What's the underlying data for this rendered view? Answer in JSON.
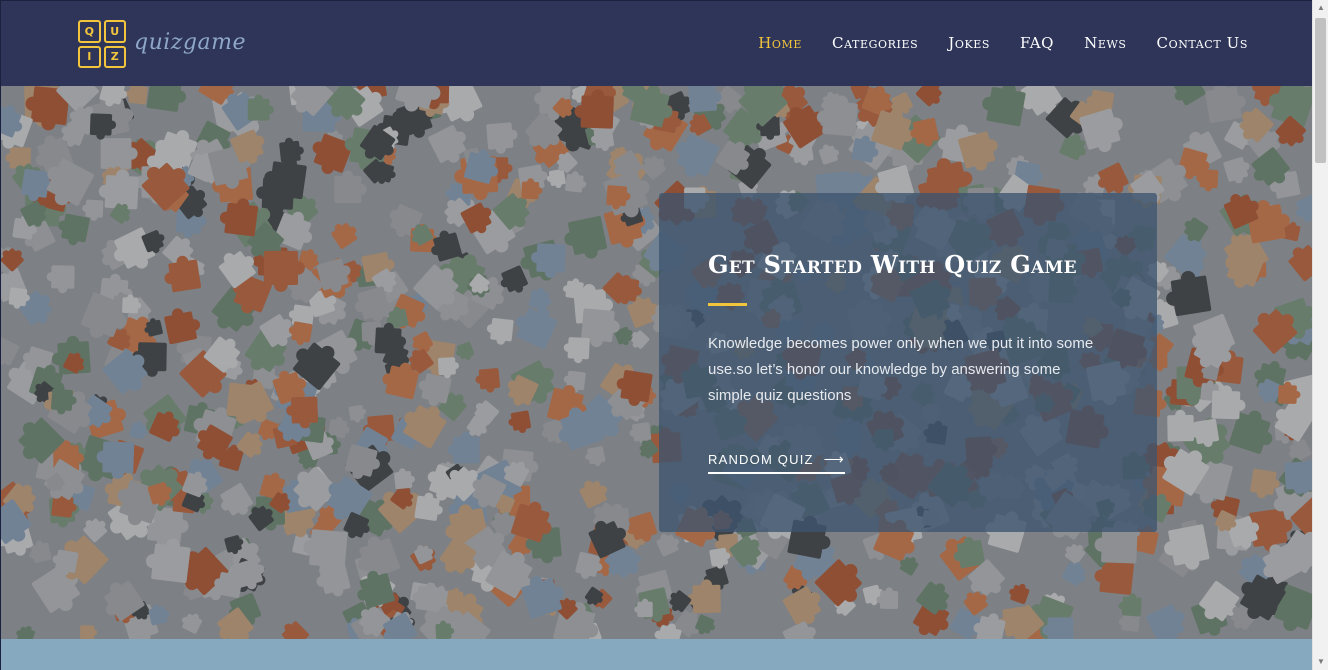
{
  "logo": {
    "letters": [
      "Q",
      "U",
      "I",
      "Z"
    ],
    "wordmark": "quizgame"
  },
  "nav": {
    "items": [
      {
        "label": "Home",
        "active": true
      },
      {
        "label": "Categories",
        "active": false
      },
      {
        "label": "Jokes",
        "active": false
      },
      {
        "label": "FAQ",
        "active": false
      },
      {
        "label": "News",
        "active": false
      },
      {
        "label": "Contact Us",
        "active": false
      }
    ]
  },
  "hero": {
    "title": "Get Started With Quiz Game",
    "description": "Knowledge becomes power only when we put it into some use.so let’s honor our knowledge by answering some simple quiz questions",
    "cta_label": "RANDOM QUIZ",
    "cta_icon": "arrow-right-icon"
  },
  "colors": {
    "header_bg": "#2e3559",
    "accent": "#f2c53d",
    "card_bg": "#3e556e",
    "strip_bg": "#87a9bf"
  }
}
